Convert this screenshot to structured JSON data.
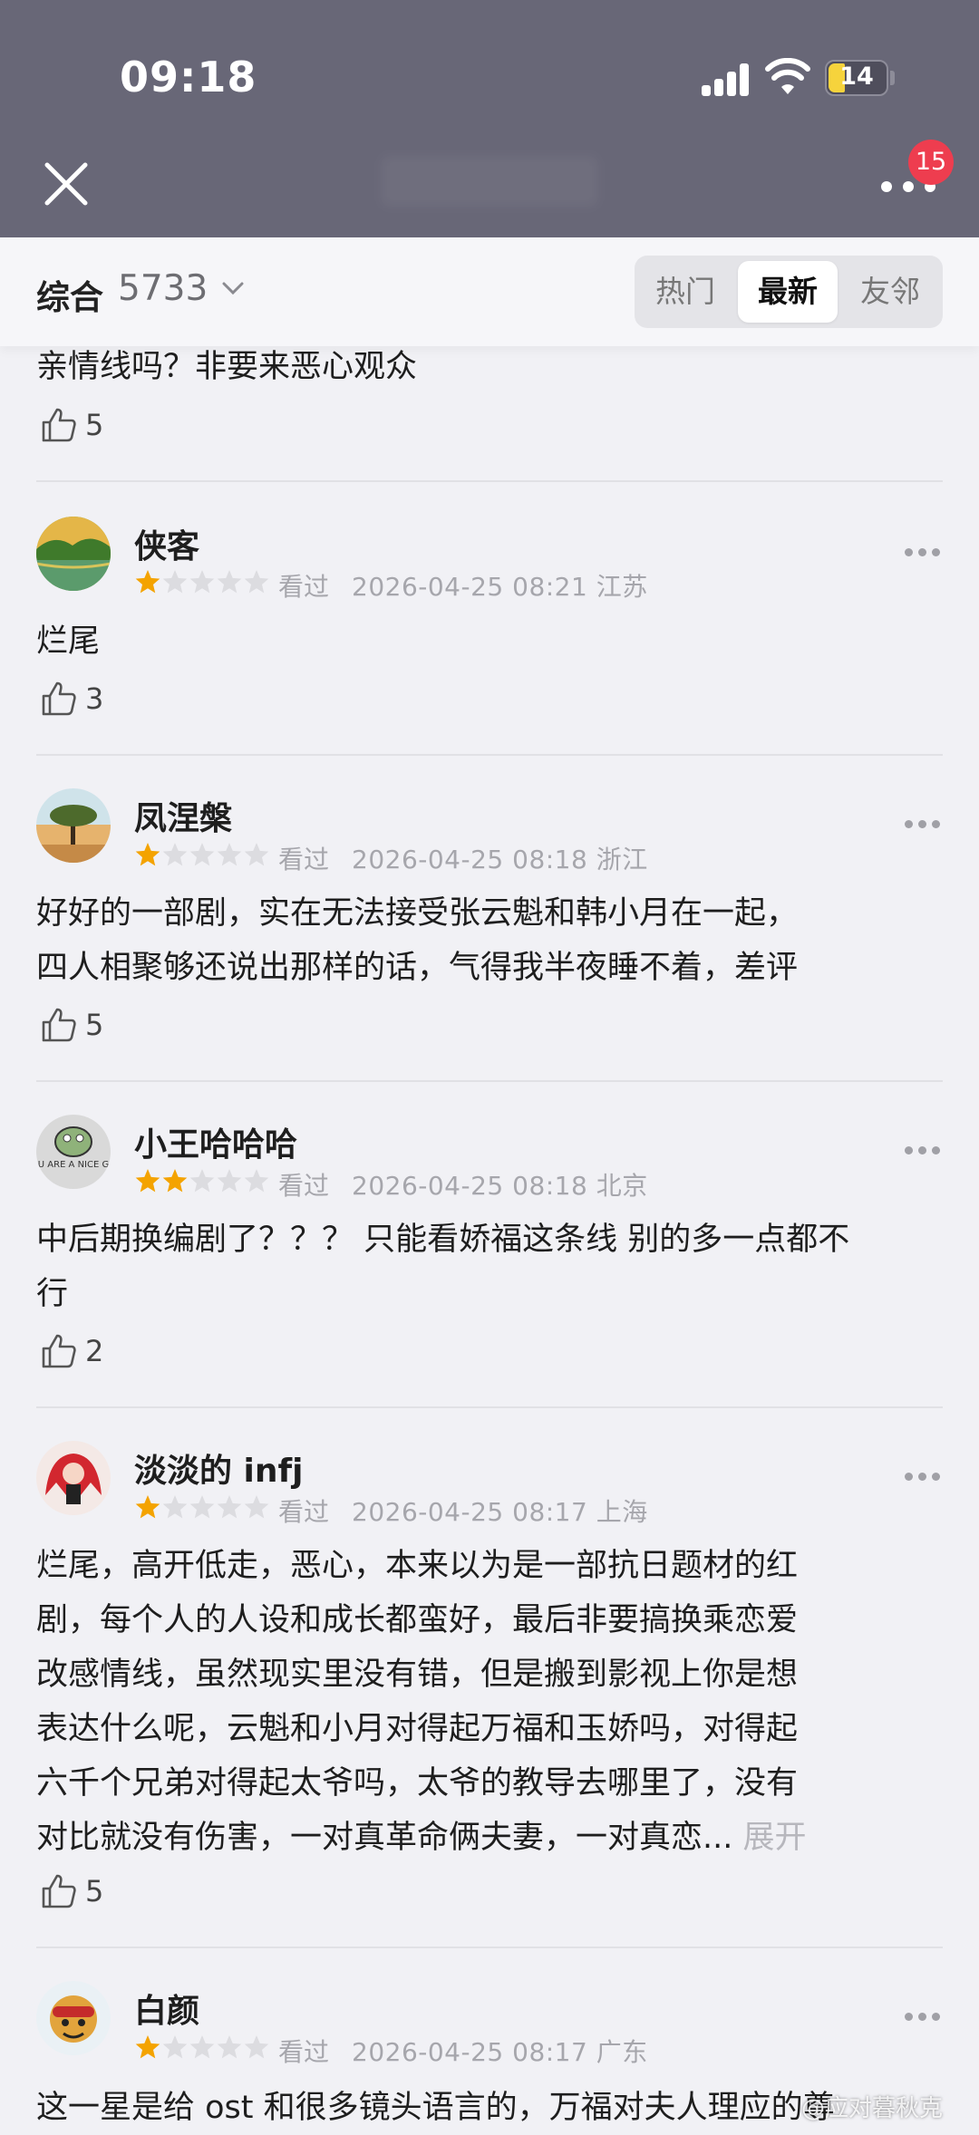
{
  "status_bar": {
    "time": "09:18",
    "battery": "14"
  },
  "nav": {
    "badge": "15",
    "colors": {
      "bar": "#686777",
      "badge": "#ee3d4f"
    }
  },
  "filter": {
    "label": "综合",
    "count": "5733",
    "tabs": [
      "热门",
      "最新",
      "友邻"
    ],
    "active_tab": "最新"
  },
  "prev_comment": {
    "text": "亲情线吗？非要来恶心观众",
    "likes": "5"
  },
  "comments": [
    {
      "user": "侠客",
      "rating": 1,
      "watched": "看过",
      "datetime": "2026-04-25 08:21",
      "region": "江苏",
      "lines": [
        "烂尾"
      ],
      "likes": "3",
      "avatar_icon": "lake-landscape-icon"
    },
    {
      "user": "凤涅槃",
      "rating": 1,
      "watched": "看过",
      "datetime": "2026-04-25 08:18",
      "region": "浙江",
      "lines": [
        "好好的一部剧，实在无法接受张云魁和韩小月在一起，",
        "四人相聚够还说出那样的话，气得我半夜睡不着，差评"
      ],
      "likes": "5",
      "avatar_icon": "tree-sunset-icon"
    },
    {
      "user": "小王哈哈哈",
      "rating": 2,
      "watched": "看过",
      "datetime": "2026-04-25 08:18",
      "region": "北京",
      "lines": [
        "中后期换编剧了？？？ 只能看娇福这条线 别的多一点都不",
        "行"
      ],
      "likes": "2",
      "avatar_icon": "frog-sticker-icon",
      "avatar_text": "YOU ARE A NICE GUY"
    },
    {
      "user": "淡淡的 infj",
      "rating": 1,
      "watched": "看过",
      "datetime": "2026-04-25 08:17",
      "region": "上海",
      "lines": [
        "烂尾，高开低走，恶心，本来以为是一部抗日题材的红",
        "剧，每个人的人设和成长都蛮好，最后非要搞换乘恋爱",
        "改感情线，虽然现实里没有错，但是搬到影视上你是想",
        "表达什么呢，云魁和小月对得起万福和玉娇吗，对得起",
        "六千个兄弟对得起太爷吗，太爷的教导去哪里了，没有",
        "对比就没有伤害，一对真革命俩夫妻，一对真恋..."
      ],
      "expand": "展开",
      "likes": "5",
      "avatar_icon": "anime-girl-icon"
    },
    {
      "user": "白颜",
      "rating": 1,
      "watched": "看过",
      "datetime": "2026-04-25 08:17",
      "region": "广东",
      "lines": [
        "这一星是给 ost 和很多镜头语言的，万福对夫人理应的尊"
      ],
      "likes": "",
      "avatar_icon": "cartoon-character-icon"
    }
  ],
  "watermark": "@应对暮秋克"
}
